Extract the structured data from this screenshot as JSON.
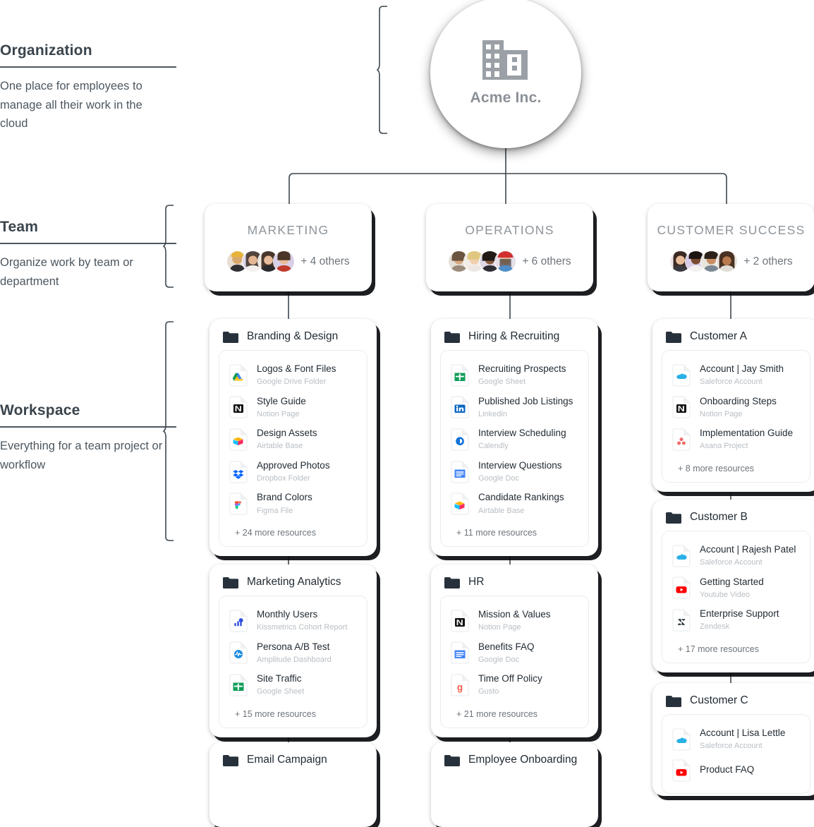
{
  "annotations": [
    {
      "title": "Organization",
      "description": "One place for employees to manage all their work in the cloud"
    },
    {
      "title": "Team",
      "description": "Organize work by team or department"
    },
    {
      "title": "Workspace",
      "description": "Everything for a team project or workflow"
    }
  ],
  "organization": {
    "name": "Acme Inc.",
    "icon": "office-building-icon"
  },
  "teams": [
    {
      "name": "MARKETING",
      "avatar_count": 4,
      "others": "+ 4 others"
    },
    {
      "name": "OPERATIONS",
      "avatar_count": 4,
      "others": "+ 6 others"
    },
    {
      "name": "CUSTOMER SUCCESS",
      "avatar_count": 4,
      "others": "+ 2 others"
    }
  ],
  "workspaces": {
    "branding": {
      "title": "Branding & Design",
      "more": "+ 24 more resources",
      "resources": [
        {
          "label": "Logos & Font Files",
          "source": "Google Drive Folder",
          "icon": "google-drive-icon"
        },
        {
          "label": "Style Guide",
          "source": "Notion Page",
          "icon": "notion-icon"
        },
        {
          "label": "Design Assets",
          "source": "Airtable Base",
          "icon": "airtable-icon"
        },
        {
          "label": "Approved Photos",
          "source": "Dropbox Folder",
          "icon": "dropbox-icon"
        },
        {
          "label": "Brand Colors",
          "source": "Figma File",
          "icon": "figma-icon"
        }
      ]
    },
    "marketing_analytics": {
      "title": "Marketing Analytics",
      "more": "+ 15 more resources",
      "resources": [
        {
          "label": "Monthly Users",
          "source": "Kissmetrics Cohort Report",
          "icon": "kissmetrics-icon"
        },
        {
          "label": "Persona A/B Test",
          "source": "Amplitude Dashboard",
          "icon": "amplitude-icon"
        },
        {
          "label": "Site Traffic",
          "source": "Google Sheet",
          "icon": "google-sheets-icon"
        }
      ]
    },
    "email_campaign": {
      "title": "Email Campaign"
    },
    "hiring": {
      "title": "Hiring & Recruiting",
      "more": "+ 11 more resources",
      "resources": [
        {
          "label": "Recruiting Prospects",
          "source": "Google Sheet",
          "icon": "google-sheets-icon"
        },
        {
          "label": "Published Job Listings",
          "source": "Linkedin",
          "icon": "linkedin-icon"
        },
        {
          "label": "Interview Scheduling",
          "source": "Calendly",
          "icon": "calendly-icon"
        },
        {
          "label": "Interview Questions",
          "source": "Google Doc",
          "icon": "google-docs-icon"
        },
        {
          "label": "Candidate Rankings",
          "source": "Airtable Base",
          "icon": "airtable-icon"
        }
      ]
    },
    "hr": {
      "title": "HR",
      "more": "+ 21 more resources",
      "resources": [
        {
          "label": "Mission & Values",
          "source": "Notion Page",
          "icon": "notion-icon"
        },
        {
          "label": "Benefits FAQ",
          "source": "Google Doc",
          "icon": "google-docs-icon"
        },
        {
          "label": "Time Off Policy",
          "source": "Gusto",
          "icon": "gusto-icon"
        }
      ]
    },
    "employee_onboarding": {
      "title": "Employee Onboarding"
    },
    "customer_a": {
      "title": "Customer A",
      "more": "+ 8 more resources",
      "resources": [
        {
          "label": "Account | Jay Smith",
          "source": "Saleforce Account",
          "icon": "salesforce-icon"
        },
        {
          "label": "Onboarding Steps",
          "source": "Notion Page",
          "icon": "notion-icon"
        },
        {
          "label": "Implementation Guide",
          "source": "Asana Project",
          "icon": "asana-icon"
        }
      ]
    },
    "customer_b": {
      "title": "Customer B",
      "more": "+ 17 more resources",
      "resources": [
        {
          "label": "Account | Rajesh Patel",
          "source": "Saleforce Account",
          "icon": "salesforce-icon"
        },
        {
          "label": "Getting Started",
          "source": "Youtube Video",
          "icon": "youtube-icon"
        },
        {
          "label": "Enterprise Support",
          "source": "Zendesk",
          "icon": "zendesk-icon"
        }
      ]
    },
    "customer_c": {
      "title": "Customer C",
      "resources": [
        {
          "label": "Account | Lisa Lettle",
          "source": "Saleforce Account",
          "icon": "salesforce-icon"
        },
        {
          "label": "Product FAQ",
          "source": "",
          "icon": "youtube-icon"
        }
      ]
    }
  },
  "colors": {
    "line": "#3d474f",
    "text_dark": "#222b33",
    "text_muted": "#b9bec3",
    "card_shadow": "#0a0c0f"
  }
}
